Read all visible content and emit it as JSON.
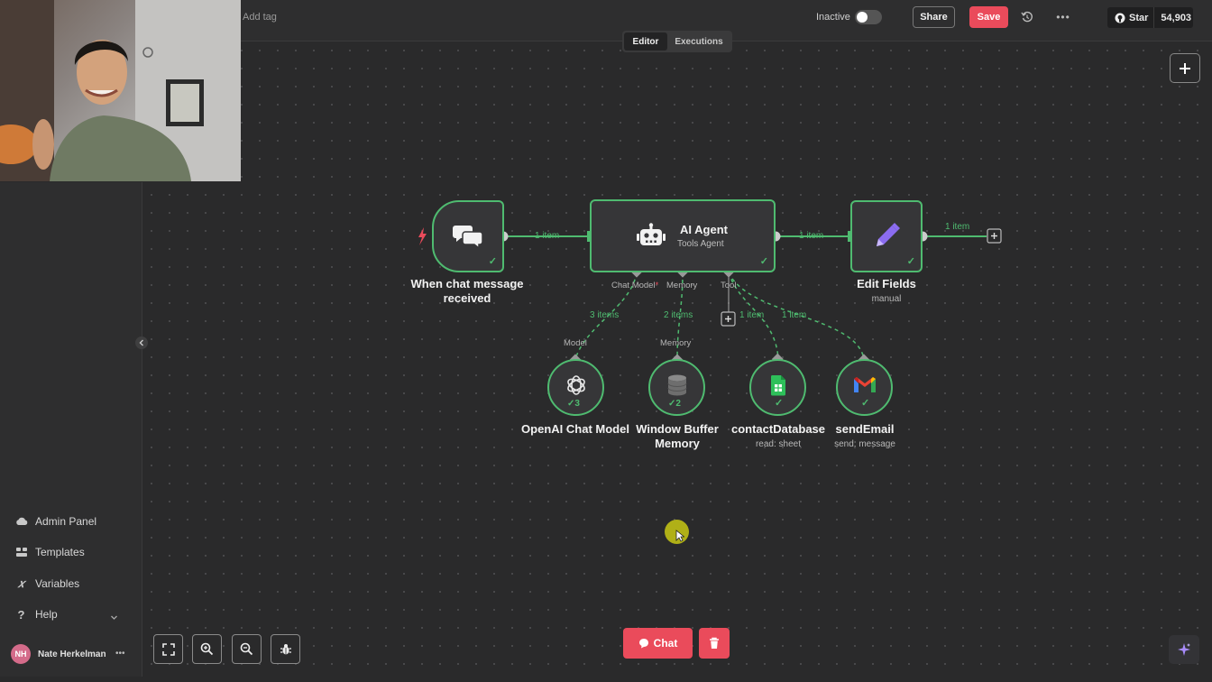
{
  "topbar": {
    "add_tag": "Add tag",
    "active_label": "Inactive",
    "share_label": "Share",
    "save_label": "Save",
    "github_star_label": "Star",
    "github_star_count": "54,903"
  },
  "tabs": [
    {
      "label": "Editor",
      "active": true
    },
    {
      "label": "Executions",
      "active": false
    }
  ],
  "sidebar": {
    "items": [
      {
        "label": "Admin Panel",
        "icon": "cloud-icon"
      },
      {
        "label": "Templates",
        "icon": "templates-icon"
      },
      {
        "label": "Variables",
        "icon": "variables-icon"
      },
      {
        "label": "Help",
        "icon": "help-icon"
      }
    ],
    "user": {
      "initials": "NH",
      "name": "Nate Herkelman"
    }
  },
  "workflow": {
    "nodes": {
      "trigger": {
        "label_line1": "When chat message",
        "label_line2": "received",
        "icon": "chat-bubbles-icon"
      },
      "agent": {
        "title": "AI Agent",
        "subtitle": "Tools Agent",
        "icon": "robot-icon"
      },
      "edit_fields": {
        "label": "Edit Fields",
        "subtitle": "manual",
        "icon": "pencil-icon"
      },
      "openai": {
        "label": "OpenAI Chat Model",
        "badge": "3",
        "icon": "openai-icon"
      },
      "memory": {
        "label_line1": "Window Buffer",
        "label_line2": "Memory",
        "badge": "2",
        "icon": "database-icon"
      },
      "contact_db": {
        "label": "contactDatabase",
        "subtitle": "read: sheet",
        "icon": "google-sheets-icon"
      },
      "send_email": {
        "label": "sendEmail",
        "subtitle": "send: message",
        "icon": "gmail-icon"
      }
    },
    "ports": {
      "chat_model": "Chat Model",
      "chat_model_required": "*",
      "memory": "Memory",
      "tool": "Tool",
      "model": "Model",
      "memory_in": "Memory"
    },
    "edges": {
      "trigger_agent": "1 item",
      "agent_edit": "1 item",
      "edit_out": "1 item",
      "model": "3 items",
      "memory": "2 items",
      "tool_contact": "1 item",
      "tool_email": "1 item"
    }
  },
  "bottom": {
    "chat_label": "Chat"
  },
  "colors": {
    "accent_green": "#4fbb70",
    "primary_red": "#ea4b5b",
    "canvas_bg": "#2a2a2b"
  }
}
